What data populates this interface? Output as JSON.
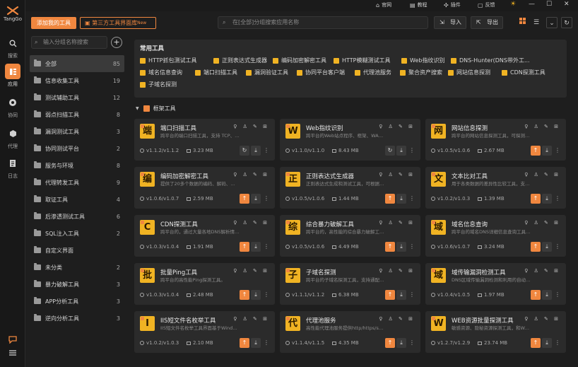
{
  "brand": {
    "name": "TangGo",
    "accent": "#f0873f",
    "chip_color": "#f0b323"
  },
  "rail": [
    {
      "label": "搜索",
      "icon": "search-icon",
      "active": false
    },
    {
      "label": "应用",
      "icon": "apps-icon",
      "active": true
    },
    {
      "label": "协同",
      "icon": "cooperation-icon",
      "active": false
    },
    {
      "label": "代理",
      "icon": "proxy-icon",
      "active": false
    },
    {
      "label": "日志",
      "icon": "log-icon",
      "active": false
    }
  ],
  "topnav": [
    {
      "label": "官网",
      "icon": "home-icon"
    },
    {
      "label": "教程",
      "icon": "book-icon"
    },
    {
      "label": "插件",
      "icon": "plugin-icon"
    },
    {
      "label": "反馈",
      "icon": "feedback-icon"
    }
  ],
  "window": {
    "theme": "☀",
    "minimize": "—",
    "maximize": "☐",
    "close": "✕"
  },
  "toolbar": {
    "add_label": "添加我的工具",
    "third_party_label": "第三方工具界面库",
    "third_party_badge": "New",
    "search_placeholder": "在[全部]分组搜索应用名称",
    "import_label": "导入",
    "export_label": "导出"
  },
  "category_panel": {
    "search_placeholder": "输入分组名称搜索",
    "add": "+",
    "items": [
      {
        "name": "全部",
        "count": "85",
        "active": true
      },
      {
        "name": "信息收集工具",
        "count": "19"
      },
      {
        "name": "测试辅助工具",
        "count": "12"
      },
      {
        "name": "弱点扫描工具",
        "count": "8"
      },
      {
        "name": "漏洞测试工具",
        "count": "3"
      },
      {
        "name": "协同测试平台",
        "count": "2"
      },
      {
        "name": "服务与环境",
        "count": "8"
      },
      {
        "name": "代理转发工具",
        "count": "9"
      },
      {
        "name": "取证工具",
        "count": "4"
      },
      {
        "name": "后渗透测试工具",
        "count": "6"
      },
      {
        "name": "SQL注入工具",
        "count": "2"
      },
      {
        "name": "自定义界面",
        "count": ""
      },
      {
        "name": "未分类",
        "count": "2"
      },
      {
        "name": "暴力破解工具",
        "count": "3"
      },
      {
        "name": "APP分析工具",
        "count": "3"
      },
      {
        "name": "逆向分析工具",
        "count": "3"
      }
    ]
  },
  "common": {
    "title": "常用工具",
    "rows": [
      [
        "HTTP抓包测试工具",
        "正则表达式生成器",
        "编码加密解密工具",
        "HTTP模糊测试工具",
        "Web指纹识别",
        "DNS-Hunter(DNS带外工..."
      ],
      [
        "域名信息查询",
        "端口扫描工具",
        "漏洞验证工具",
        "协同平台客户端",
        "代理池服务",
        "聚合资产搜索",
        "网站信息探测",
        "CDN探测工具"
      ],
      [
        "子域名探测"
      ]
    ]
  },
  "group": {
    "title": "框架工具"
  },
  "cards": [
    {
      "glyph": "端",
      "title": "端口扫描工具",
      "desc": "跨平台的端口扫描工具，支持 TCP、SYN、U...",
      "version": "v1.1.2/v1.1.2",
      "size": "3.23 MB",
      "action": "refresh"
    },
    {
      "glyph": "W",
      "title": "Web指纹识别",
      "desc": "跨平台的Web站点程序、框架、WAF指纹识...",
      "version": "v1.1.0/v1.1.0",
      "size": "8.43 MB",
      "action": "refresh"
    },
    {
      "glyph": "网",
      "title": "网站信息探测",
      "desc": "跨平台的网站信息探测工具，可探测网站的存...",
      "version": "v1.0.5/v1.0.6",
      "size": "2.67 MB",
      "action": "upgrade"
    },
    {
      "glyph": "编",
      "title": "编码加密解密工具",
      "desc": "提供了20多个数据的编码、解码、加密、解密...",
      "version": "v1.0.6/v1.0.7",
      "size": "2.59 MB",
      "action": "upgrade"
    },
    {
      "glyph": "正",
      "title": "正则表达式生成器",
      "desc": "正则表达式生成和测试工具，可根据选择需要...",
      "version": "v1.0.5/v1.0.6",
      "size": "1.44 MB",
      "action": "upgrade"
    },
    {
      "glyph": "文",
      "title": "文本比对工具",
      "desc": "用于各类数据的差异性比较工具，支持表格、...",
      "version": "v1.0.2/v1.0.3",
      "size": "1.39 MB",
      "action": "upgrade"
    },
    {
      "glyph": "C",
      "title": "CDN探测工具",
      "desc": "跨平台的，通过大量各地DNS解析情况来判断...",
      "version": "v1.0.3/v1.0.4",
      "size": "1.91 MB",
      "action": "upgrade"
    },
    {
      "glyph": "综",
      "title": "综合暴力破解工具",
      "desc": "跨平台的，高性能的综合暴力破解工具，支持对...",
      "version": "v1.0.5/v1.0.6",
      "size": "4.49 MB",
      "action": "upgrade"
    },
    {
      "glyph": "域",
      "title": "域名信息查询",
      "desc": "跨平台的域名DNS详细信息查询工具，支持...",
      "version": "v1.0.6/v1.0.7",
      "size": "3.24 MB",
      "action": "upgrade"
    },
    {
      "glyph": "批",
      "title": "批量Ping工具",
      "desc": "跨平台的高性能Ping探测工具。",
      "version": "v1.0.3/v1.0.4",
      "size": "2.48 MB",
      "action": "upgrade"
    },
    {
      "glyph": "子",
      "title": "子域名探测",
      "desc": "跨平台的子域名探测工具，支持通配符、可能...",
      "version": "v1.1.1/v1.1.2",
      "size": "6.38 MB",
      "action": "upgrade"
    },
    {
      "glyph": "域",
      "title": "域传输漏洞检测工具",
      "desc": "DNS区域传输漏洞检测和利用的自动化工具。",
      "version": "v1.0.4/v1.0.5",
      "size": "1.97 MB",
      "action": "upgrade"
    },
    {
      "glyph": "I",
      "title": "IIS短文件名枚举工具",
      "desc": "IIS短文件名枚举工具界面基于Windows短文件...",
      "version": "v1.0.2/v1.0.3",
      "size": "2.10 MB",
      "action": "upgrade"
    },
    {
      "glyph": "代",
      "title": "代理池服务",
      "desc": "高性能代理池服务提供http/https/socks5代...",
      "version": "v1.1.4/v1.1.5",
      "size": "4.35 MB",
      "action": "upgrade"
    },
    {
      "glyph": "W",
      "title": "WEB资源批量探测工具",
      "desc": "敏感资源、隐秘资源探测工具，和Web资源探...",
      "version": "v1.2.7/v1.2.9",
      "size": "23.74 MB",
      "action": "upgrade"
    }
  ],
  "card_tool_icons": "♀ ♙ ✎ ⊞"
}
